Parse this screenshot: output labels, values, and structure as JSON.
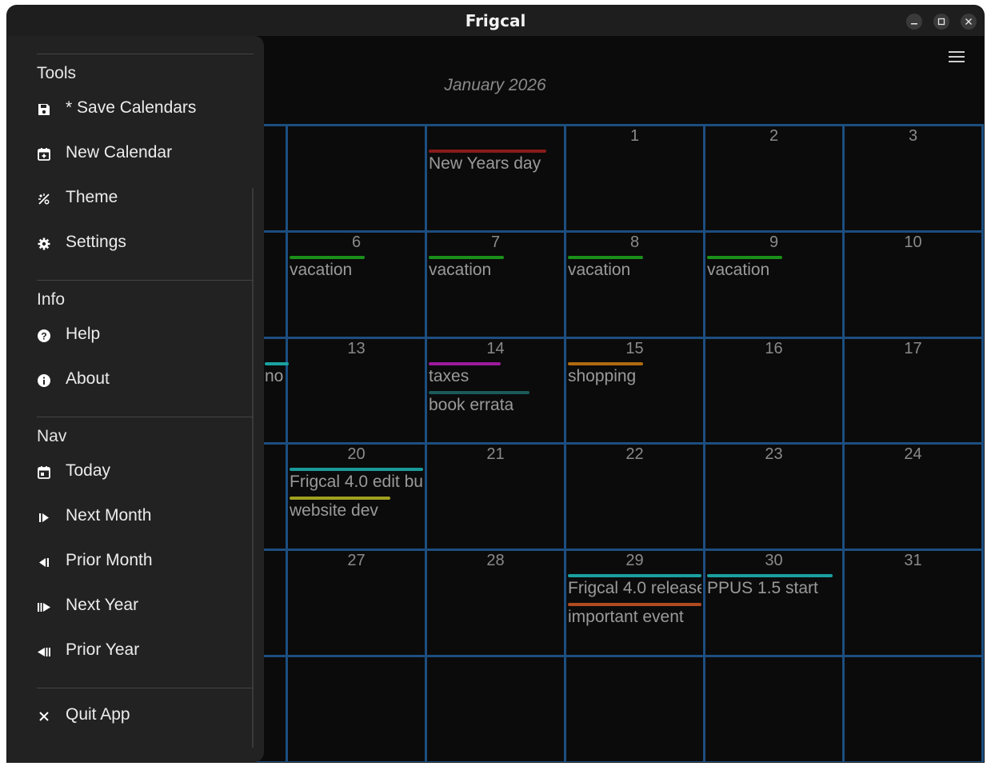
{
  "window": {
    "title": "Frigcal"
  },
  "header": {
    "month_title": "January 2026"
  },
  "drawer": {
    "sections": [
      {
        "title": "Tools",
        "items": [
          {
            "label": "* Save Calendars",
            "icon": "save-icon"
          },
          {
            "label": "New Calendar",
            "icon": "calendar-plus-icon"
          },
          {
            "label": "Theme",
            "icon": "theme-icon"
          },
          {
            "label": "Settings",
            "icon": "gear-icon"
          }
        ]
      },
      {
        "title": "Info",
        "items": [
          {
            "label": "Help",
            "icon": "help-icon"
          },
          {
            "label": "About",
            "icon": "info-icon"
          }
        ]
      },
      {
        "title": "Nav",
        "items": [
          {
            "label": "Today",
            "icon": "calendar-today-icon"
          },
          {
            "label": "Next Month",
            "icon": "next-month-icon"
          },
          {
            "label": "Prior Month",
            "icon": "prior-month-icon"
          },
          {
            "label": "Next Year",
            "icon": "next-year-icon"
          },
          {
            "label": "Prior Year",
            "icon": "prior-year-icon"
          }
        ]
      }
    ],
    "quit": {
      "label": "Quit App",
      "icon": "close-icon"
    }
  },
  "calendar": {
    "colors": {
      "grid": "#1d4e80",
      "daynum": "#8a8a8a"
    },
    "weeks": [
      [
        "",
        "",
        "",
        "1",
        "2",
        "3"
      ],
      [
        "",
        "6",
        "7",
        "8",
        "9",
        "10"
      ],
      [
        "",
        "13",
        "14",
        "15",
        "16",
        "17"
      ],
      [
        "",
        "20",
        "21",
        "22",
        "23",
        "24"
      ],
      [
        "",
        "27",
        "28",
        "29",
        "30",
        "31"
      ],
      [
        "",
        "",
        "",
        "",
        "",
        ""
      ]
    ],
    "events": [
      {
        "week": 0,
        "col": 3,
        "slot": 0,
        "label": "New Years day",
        "color": "#8b1a1a"
      },
      {
        "week": 1,
        "col": 2,
        "slot": 0,
        "label": "vacation",
        "color": "#1a8f1a"
      },
      {
        "week": 1,
        "col": 3,
        "slot": 0,
        "label": "vacation",
        "color": "#1a8f1a"
      },
      {
        "week": 1,
        "col": 4,
        "slot": 0,
        "label": "vacation",
        "color": "#1a8f1a"
      },
      {
        "week": 1,
        "col": 5,
        "slot": 0,
        "label": "vacation",
        "color": "#1a8f1a"
      },
      {
        "week": 2,
        "col": 0,
        "slot": 0,
        "label": "no",
        "color": "#1aa0a0"
      },
      {
        "week": 2,
        "col": 3,
        "slot": 0,
        "label": "taxes",
        "color": "#9c1a9c"
      },
      {
        "week": 2,
        "col": 3,
        "slot": 1,
        "label": "book errata",
        "color": "#1a5a5a"
      },
      {
        "week": 2,
        "col": 4,
        "slot": 0,
        "label": "shopping",
        "color": "#b06a10"
      },
      {
        "week": 3,
        "col": 2,
        "slot": 0,
        "label": "Frigcal 4.0  edit bu",
        "color": "#1a9a9a"
      },
      {
        "week": 3,
        "col": 2,
        "slot": 1,
        "label": "website dev",
        "color": "#a0a020"
      },
      {
        "week": 4,
        "col": 4,
        "slot": 0,
        "label": "Frigcal 4.0 release",
        "color": "#1aa0a0"
      },
      {
        "week": 4,
        "col": 4,
        "slot": 1,
        "label": "important event",
        "color": "#b04a20"
      },
      {
        "week": 4,
        "col": 5,
        "slot": 0,
        "label": "PPUS 1.5 start",
        "color": "#1aa0a0"
      }
    ]
  }
}
